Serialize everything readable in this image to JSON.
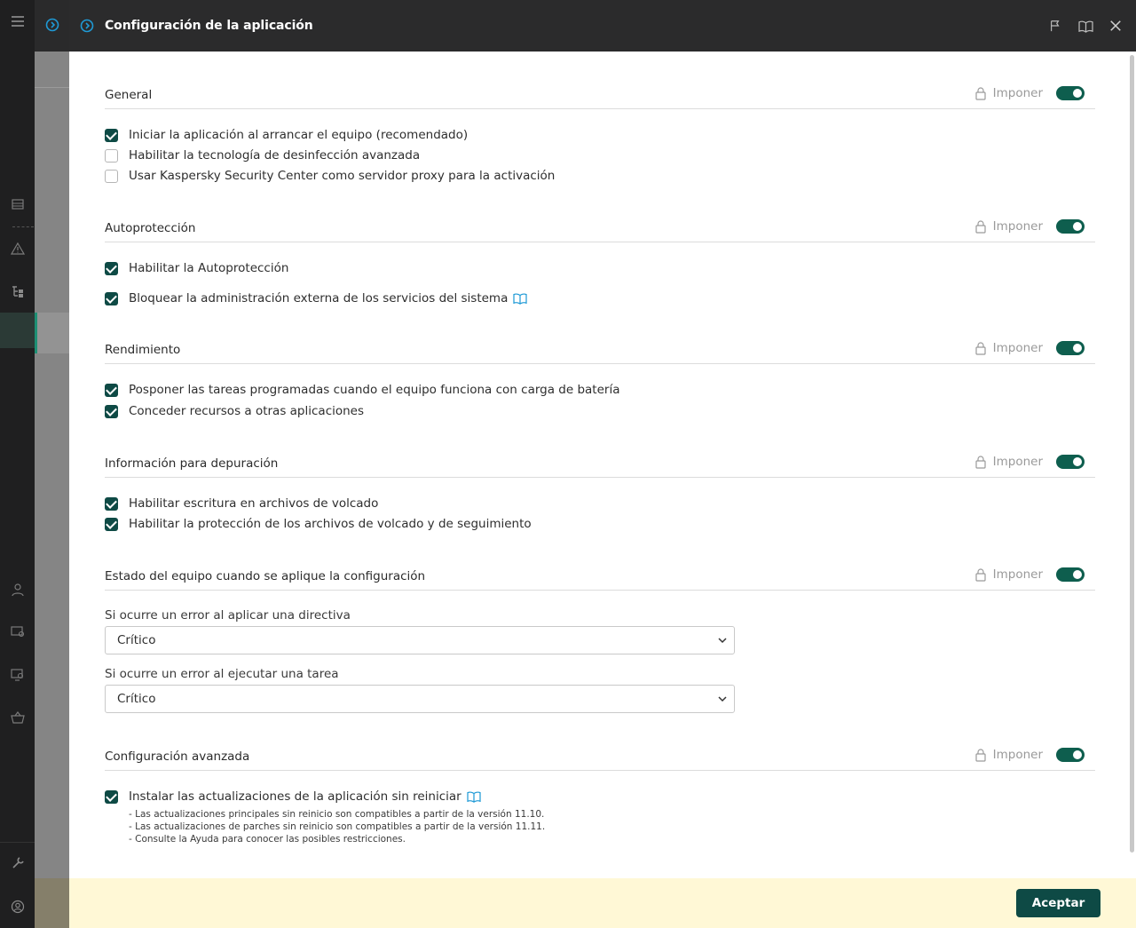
{
  "window": {
    "title": "Configuración de la aplicación",
    "actions": [
      "flag-icon",
      "book-icon",
      "close-icon"
    ]
  },
  "enforce_label": "Imponer",
  "sections": {
    "general": {
      "title": "General",
      "enforced": true,
      "options": [
        {
          "label": "Iniciar la aplicación al arrancar el equipo (recomendado)",
          "checked": true
        },
        {
          "label": "Habilitar la tecnología de desinfección avanzada",
          "checked": false
        },
        {
          "label": "Usar Kaspersky Security Center como servidor proxy para la activación",
          "checked": false
        }
      ]
    },
    "selfprotect": {
      "title": "Autoprotección",
      "enforced": true,
      "options": [
        {
          "label": "Habilitar la Autoprotección",
          "checked": true
        },
        {
          "label": "Bloquear la administración externa de los servicios del sistema",
          "checked": true
        }
      ]
    },
    "performance": {
      "title": "Rendimiento",
      "enforced": true,
      "options": [
        {
          "label": "Posponer las tareas programadas cuando el equipo funciona con carga de batería",
          "checked": true
        },
        {
          "label": "Conceder recursos a otras aplicaciones",
          "checked": true
        }
      ]
    },
    "debug": {
      "title": "Información para depuración",
      "enforced": true,
      "options": [
        {
          "label": "Habilitar escritura en archivos de volcado",
          "checked": true
        },
        {
          "label": "Habilitar la protección de los archivos de volcado y de seguimiento",
          "checked": true
        }
      ]
    },
    "state": {
      "title": "Estado del equipo cuando se aplique la configuración",
      "enforced": true,
      "policy_error_label": "Si ocurre un error al aplicar una directiva",
      "policy_error_value": "Crítico",
      "task_error_label": "Si ocurre un error al ejecutar una tarea",
      "task_error_value": "Crítico"
    },
    "advanced": {
      "title": "Configuración avanzada",
      "enforced": true,
      "options": [
        {
          "label": "Instalar las actualizaciones de la aplicación sin reiniciar",
          "checked": true
        }
      ],
      "notes": [
        "- Las actualizaciones principales sin reinicio son compatibles a partir de la versión 11.10.",
        "- Las actualizaciones de parches sin reinicio son compatibles a partir de la versión 11.11.",
        "- Consulte la Ayuda para conocer las posibles restricciones."
      ]
    }
  },
  "footer": {
    "accept_label": "Aceptar"
  },
  "colors": {
    "accent": "#0e4a45",
    "toggle": "#0e5e4e",
    "footer_bg": "#fff8d6",
    "titlebar_bg": "#2b2b2c",
    "link_icon": "#1f9ad6"
  }
}
